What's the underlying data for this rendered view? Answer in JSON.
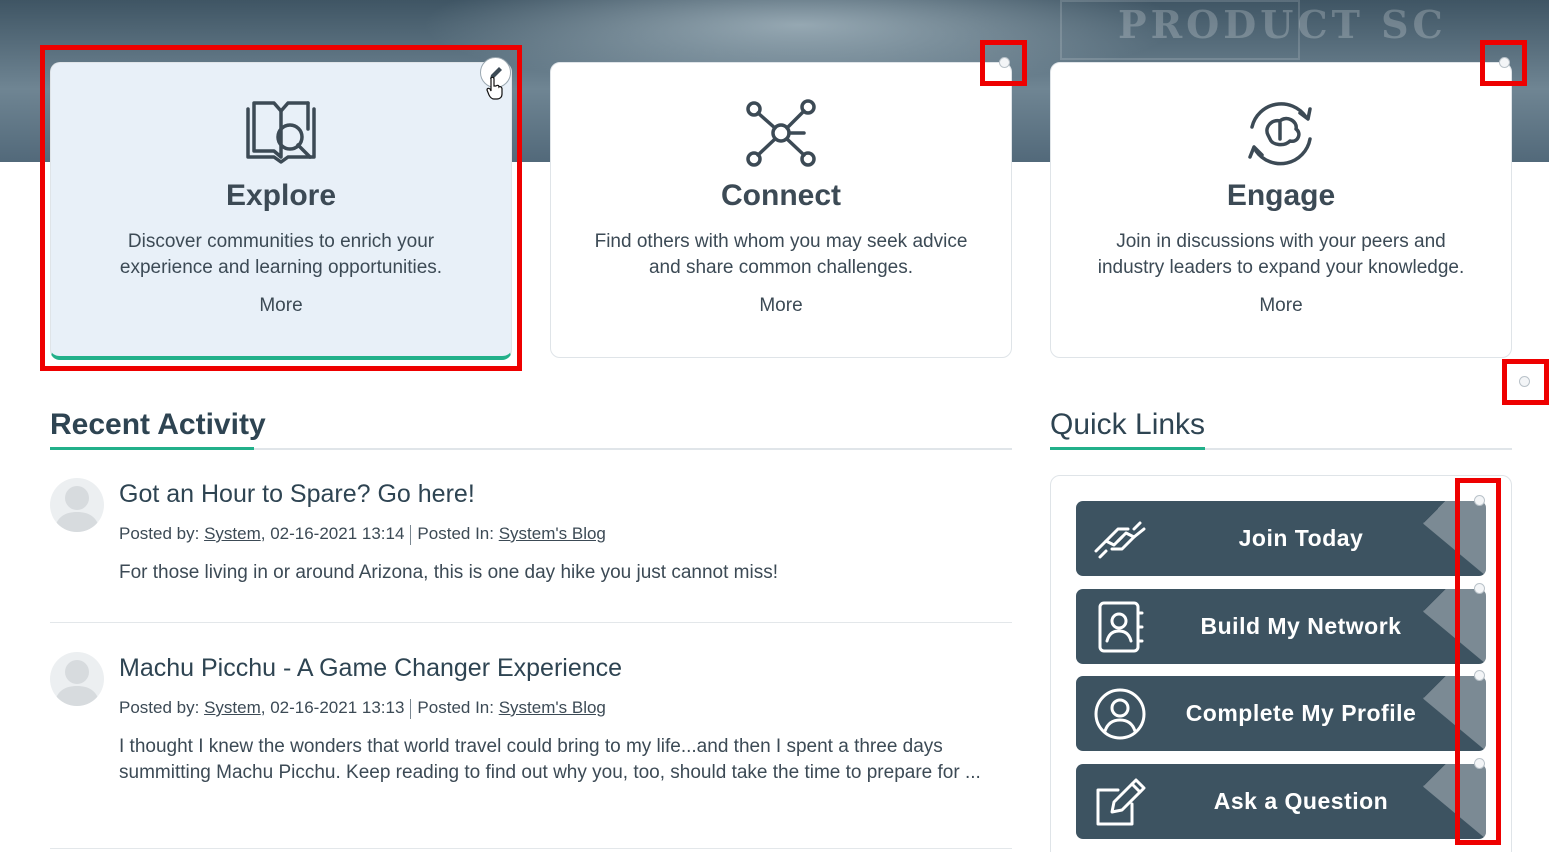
{
  "hero": {
    "watermark_text": "PRODUCT SC"
  },
  "cards": [
    {
      "title": "Explore",
      "description": "Discover communities to enrich your experience and learning opportunities.",
      "more": "More",
      "icon": "book-search-icon"
    },
    {
      "title": "Connect",
      "description": "Find others with whom you may seek advice and share common challenges.",
      "more": "More",
      "icon": "network-icon"
    },
    {
      "title": "Engage",
      "description": "Join in discussions with your peers and industry leaders to expand your knowledge.",
      "more": "More",
      "icon": "brain-cycle-icon"
    }
  ],
  "recent_activity": {
    "title": "Recent Activity",
    "items": [
      {
        "title": "Got an Hour to Spare? Go here!",
        "posted_by_label": "Posted by:",
        "author": "System",
        "timestamp": ", 02-16-2021 13:14",
        "posted_in_label": "Posted In:",
        "blog": "System's Blog",
        "excerpt": "For those living in or around Arizona, this is one day hike you just cannot miss!"
      },
      {
        "title": "Machu Picchu - A Game Changer Experience",
        "posted_by_label": "Posted by:",
        "author": "System",
        "timestamp": ", 02-16-2021 13:13",
        "posted_in_label": "Posted In:",
        "blog": "System's Blog",
        "excerpt": "I thought I knew the wonders that world travel could bring to my life...and then I spent a three days summitting Machu Picchu. Keep reading to find out why you, too, should take the time to prepare for ..."
      }
    ]
  },
  "quick_links": {
    "title": "Quick Links",
    "items": [
      {
        "label": "Join Today",
        "icon": "handshake-icon"
      },
      {
        "label": "Build My Network",
        "icon": "contact-book-icon"
      },
      {
        "label": "Complete My Profile",
        "icon": "user-circle-icon"
      },
      {
        "label": "Ask a Question",
        "icon": "edit-square-icon"
      }
    ]
  },
  "colors": {
    "accent": "#22b08a",
    "button_bg": "#3d5361",
    "highlight": "#ee0000",
    "active_card_bg": "#e8f0f8"
  }
}
